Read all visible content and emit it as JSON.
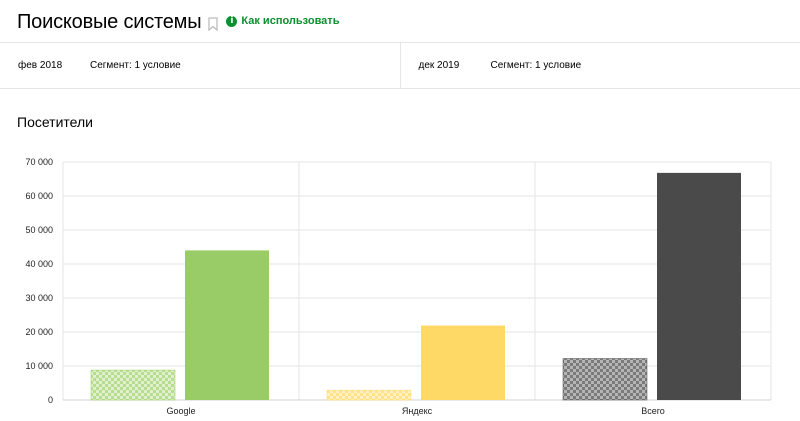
{
  "header": {
    "title": "Поисковые системы",
    "help_label": "Как использовать",
    "help_icon": "i"
  },
  "segments": [
    {
      "period": "фев 2018",
      "condition": "Сегмент: 1 условие"
    },
    {
      "period": "дек 2019",
      "condition": "Сегмент: 1 условие"
    }
  ],
  "section": {
    "title": "Посетители"
  },
  "chart_data": {
    "type": "bar",
    "categories": [
      "Google",
      "Яндекс",
      "Всего"
    ],
    "series": [
      {
        "values": [
          8800,
          2900,
          12200
        ],
        "patterned": true
      },
      {
        "values": [
          44000,
          21900,
          66800
        ],
        "patterned": false
      }
    ],
    "colors": {
      "Google": "#99cc66",
      "Яндекс": "#ffd966",
      "Всего": "#4a4a4a"
    },
    "ylim": [
      0,
      70000
    ],
    "yticks": [
      0,
      10000,
      20000,
      30000,
      40000,
      50000,
      60000,
      70000
    ],
    "ytick_labels": [
      "0",
      "10 000",
      "20 000",
      "30 000",
      "40 000",
      "50 000",
      "60 000",
      "70 000"
    ],
    "grid": true
  }
}
